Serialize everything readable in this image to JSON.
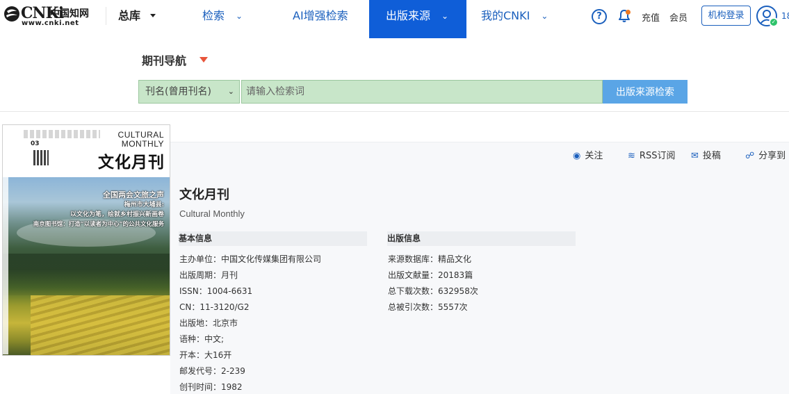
{
  "logo": {
    "cnki": "CNKi",
    "chinese": "中国知网",
    "url": "www.cnki.net"
  },
  "nav": {
    "zongku": "总库",
    "search": "检索",
    "ai_search": "AI增强检索",
    "publication_source": "出版来源",
    "my_cnki": "我的CNKI"
  },
  "header": {
    "help": "?",
    "recharge": "充值",
    "member": "会员",
    "institution_login": "机构登录",
    "user_number": "18"
  },
  "search": {
    "section_title": "期刊导航",
    "field_selected": "刊名(曾用刊名)",
    "placeholder": "请输入检索词",
    "button": "出版来源检索"
  },
  "actions": {
    "follow": "关注",
    "rss": "RSS订阅",
    "submit": "投稿",
    "share": "分享到"
  },
  "cover": {
    "en_line1": "CULTURAL",
    "en_line2": "MONTHLY",
    "cn_title": "文化月刊",
    "issue": "03",
    "headline1": "全国两会文旅之声",
    "headline2": "梅州市大埔县:",
    "headline3": "以文化为笔，绘就乡村振兴新画卷",
    "headline4": "南京图书馆：打造“以读者为中心”的公共文化服务"
  },
  "journal": {
    "title": "文化月刊",
    "english_title": "Cultural Monthly",
    "basic_info_heading": "基本信息",
    "publication_info_heading": "出版信息",
    "basic_info": [
      {
        "label": "主办单位：",
        "value": "中国文化传媒集团有限公司"
      },
      {
        "label": "出版周期：",
        "value": "月刊"
      },
      {
        "label": "ISSN：",
        "value": "1004-6631"
      },
      {
        "label": "CN：",
        "value": "11-3120/G2"
      },
      {
        "label": "出版地：",
        "value": "北京市"
      },
      {
        "label": "语种：",
        "value": "中文;"
      },
      {
        "label": "开本：",
        "value": "大16开"
      },
      {
        "label": "邮发代号：",
        "value": "2-239"
      },
      {
        "label": "创刊时间：",
        "value": "1982"
      }
    ],
    "publication_info": [
      {
        "label": "来源数据库：",
        "value": "精品文化"
      },
      {
        "label": "出版文献量：",
        "value": "20183篇"
      },
      {
        "label": "总下载次数：",
        "value": "632958次"
      },
      {
        "label": "总被引次数：",
        "value": "5557次"
      }
    ]
  },
  "colors": {
    "brand_blue": "#0f5ed8",
    "link_blue": "#1a5fbd",
    "search_field_green": "#c8e6c9",
    "search_button": "#5aa5e6",
    "accent_red": "#e8553b",
    "notify_orange": "#f07a22"
  }
}
